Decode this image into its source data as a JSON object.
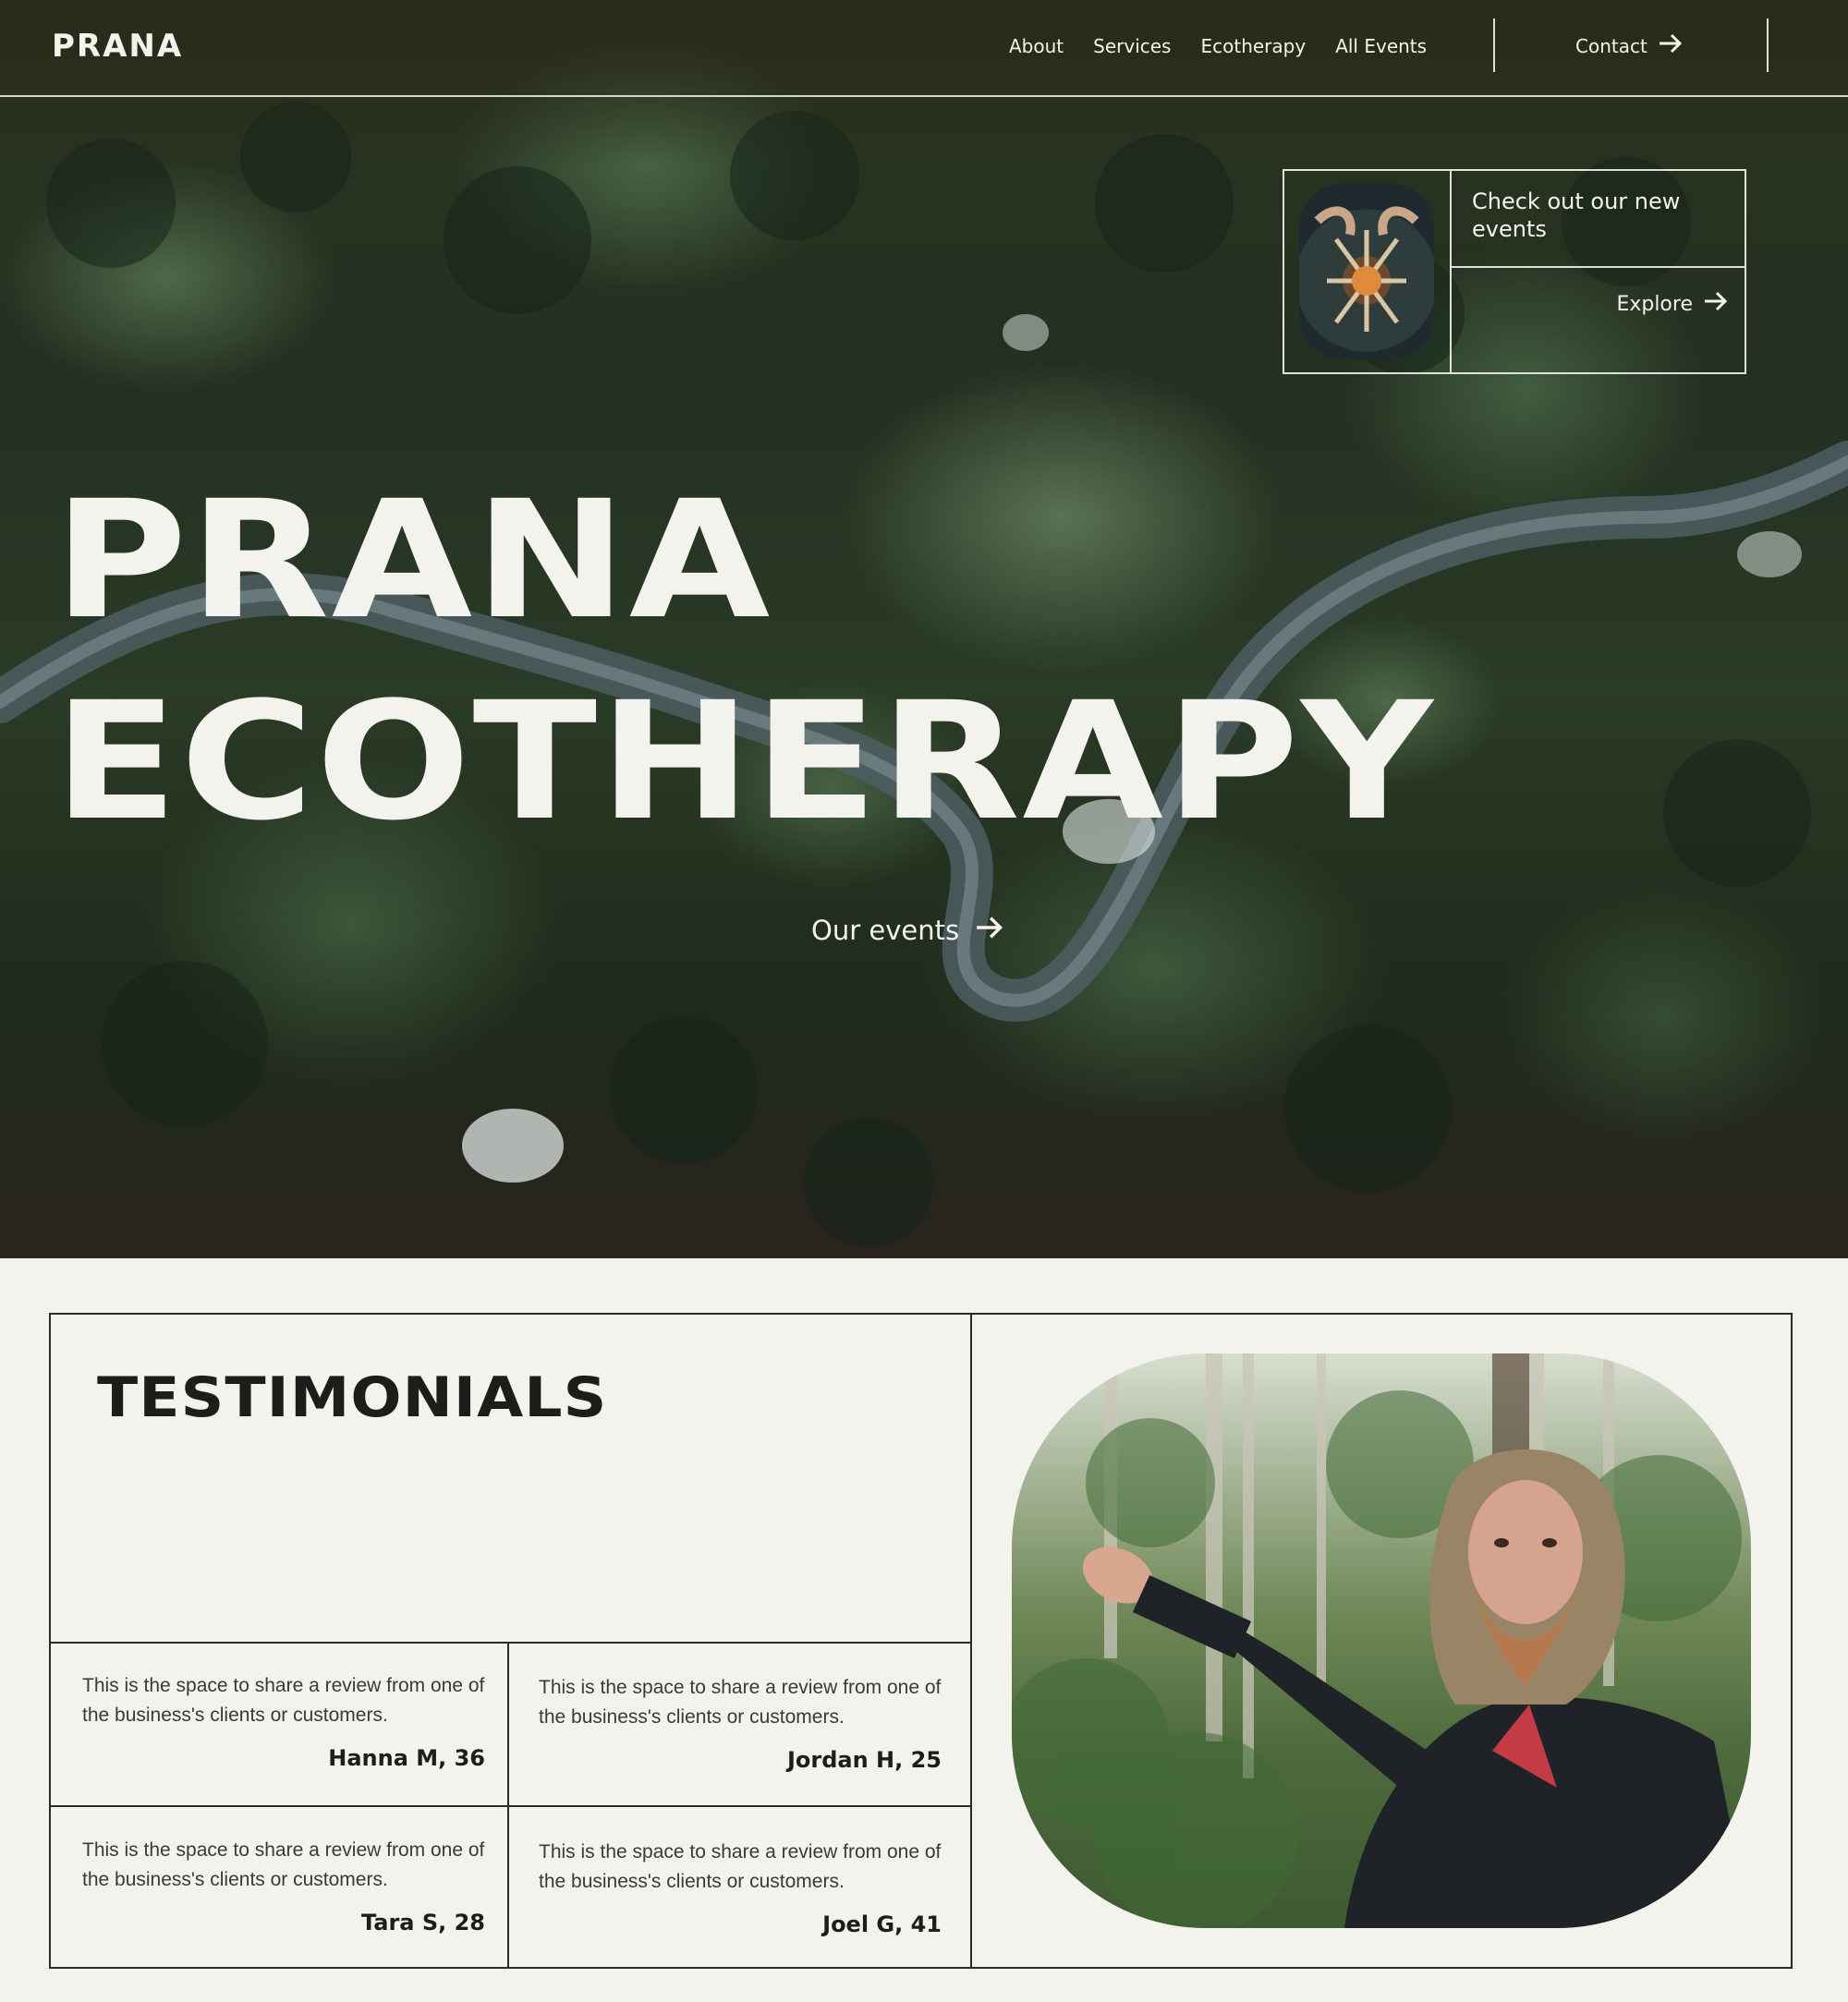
{
  "nav": {
    "logo": "PRANA",
    "links": [
      "About",
      "Services",
      "Ecotherapy",
      "All Events"
    ],
    "contact": "Contact"
  },
  "promo": {
    "text": "Check out our new events",
    "cta": "Explore"
  },
  "hero": {
    "line1": "PRANA",
    "line2": "ECOTHERAPY",
    "cta": "Our events"
  },
  "testimonials": {
    "title": "TESTIMONIALS",
    "reviews": [
      {
        "body": "This is the space to share a review from one of the business's clients or customers.",
        "author": "Hanna M, 36"
      },
      {
        "body": "This is the space to share a review from one of the business's clients or customers.",
        "author": "Jordan H, 25"
      },
      {
        "body": "This is the space to share a review from one of the business's clients or customers.",
        "author": "Tara S, 28"
      },
      {
        "body": "This is the space to share a review from one of the business's clients or customers.",
        "author": "Joel G, 41"
      }
    ]
  },
  "icons": {
    "arrow": "arrow-right-icon"
  },
  "colors": {
    "cream": "#f4f2ec",
    "ink": "#1d1d1b",
    "forest": "#2a3b26"
  }
}
